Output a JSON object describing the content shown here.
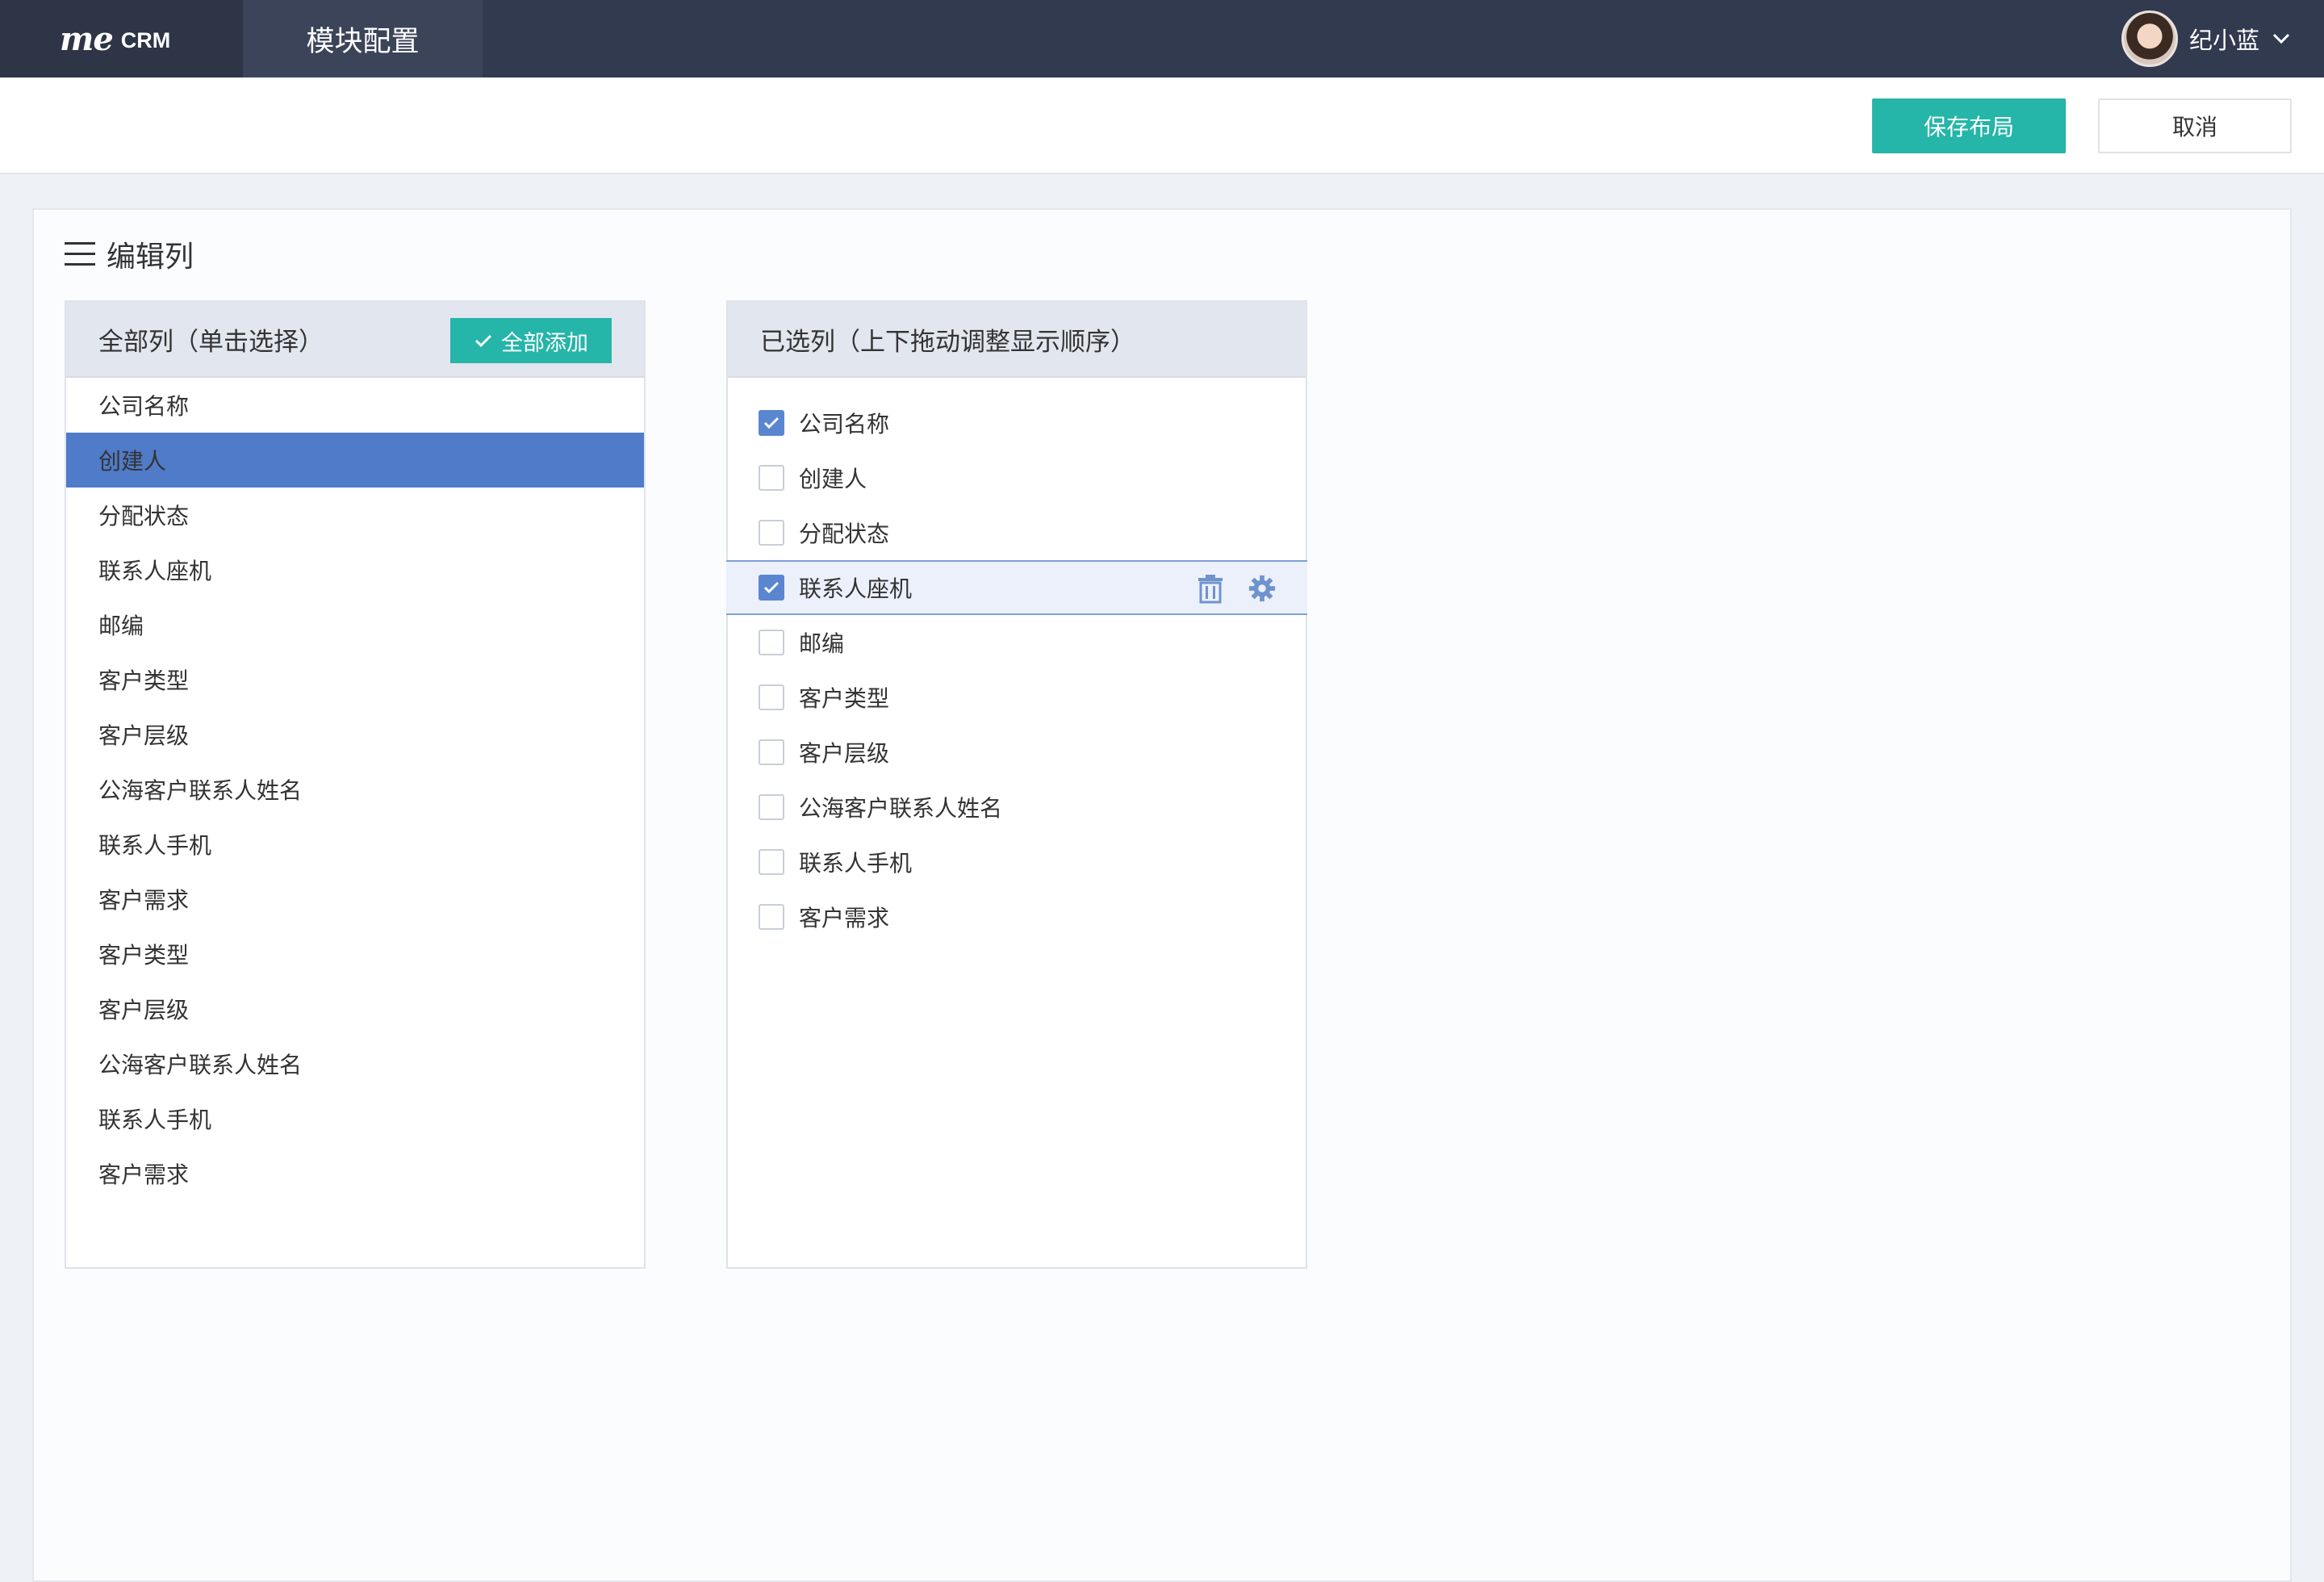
{
  "header": {
    "logo_me": "me",
    "logo_crm": "CRM",
    "module_title": "模块配置",
    "user_name": "纪小蓝"
  },
  "actions": {
    "save_label": "保存布局",
    "cancel_label": "取消"
  },
  "editor": {
    "title": "编辑列",
    "all_columns": {
      "title": "全部列（单击选择）",
      "add_all_label": "全部添加",
      "items": [
        {
          "label": "公司名称",
          "selected": false
        },
        {
          "label": "创建人",
          "selected": true
        },
        {
          "label": "分配状态",
          "selected": false
        },
        {
          "label": "联系人座机",
          "selected": false
        },
        {
          "label": "邮编",
          "selected": false
        },
        {
          "label": "客户类型",
          "selected": false
        },
        {
          "label": "客户层级",
          "selected": false
        },
        {
          "label": "公海客户联系人姓名",
          "selected": false
        },
        {
          "label": "联系人手机",
          "selected": false
        },
        {
          "label": "客户需求",
          "selected": false
        },
        {
          "label": "客户类型",
          "selected": false
        },
        {
          "label": "客户层级",
          "selected": false
        },
        {
          "label": "公海客户联系人姓名",
          "selected": false
        },
        {
          "label": "联系人手机",
          "selected": false
        },
        {
          "label": "客户需求",
          "selected": false
        }
      ]
    },
    "selected_columns": {
      "title": "已选列（上下拖动调整显示顺序）",
      "items": [
        {
          "label": "公司名称",
          "checked": true,
          "active": false
        },
        {
          "label": "创建人",
          "checked": false,
          "active": false
        },
        {
          "label": "分配状态",
          "checked": false,
          "active": false
        },
        {
          "label": "联系人座机",
          "checked": true,
          "active": true
        },
        {
          "label": "邮编",
          "checked": false,
          "active": false
        },
        {
          "label": "客户类型",
          "checked": false,
          "active": false
        },
        {
          "label": "客户层级",
          "checked": false,
          "active": false
        },
        {
          "label": "公海客户联系人姓名",
          "checked": false,
          "active": false
        },
        {
          "label": "联系人手机",
          "checked": false,
          "active": false
        },
        {
          "label": "客户需求",
          "checked": false,
          "active": false
        }
      ]
    }
  },
  "colors": {
    "topbar": "#323a4f",
    "accent": "#25b5a9",
    "selected_row": "#4f7bc8",
    "checkbox_checked": "#5a86d0",
    "icon_blue": "#6f93cc"
  },
  "icons": {
    "menu": "menu-icon",
    "add_all": "check-icon",
    "user_menu": "chevron-down-icon",
    "row_delete": "trash-icon",
    "row_settings": "gear-icon"
  }
}
